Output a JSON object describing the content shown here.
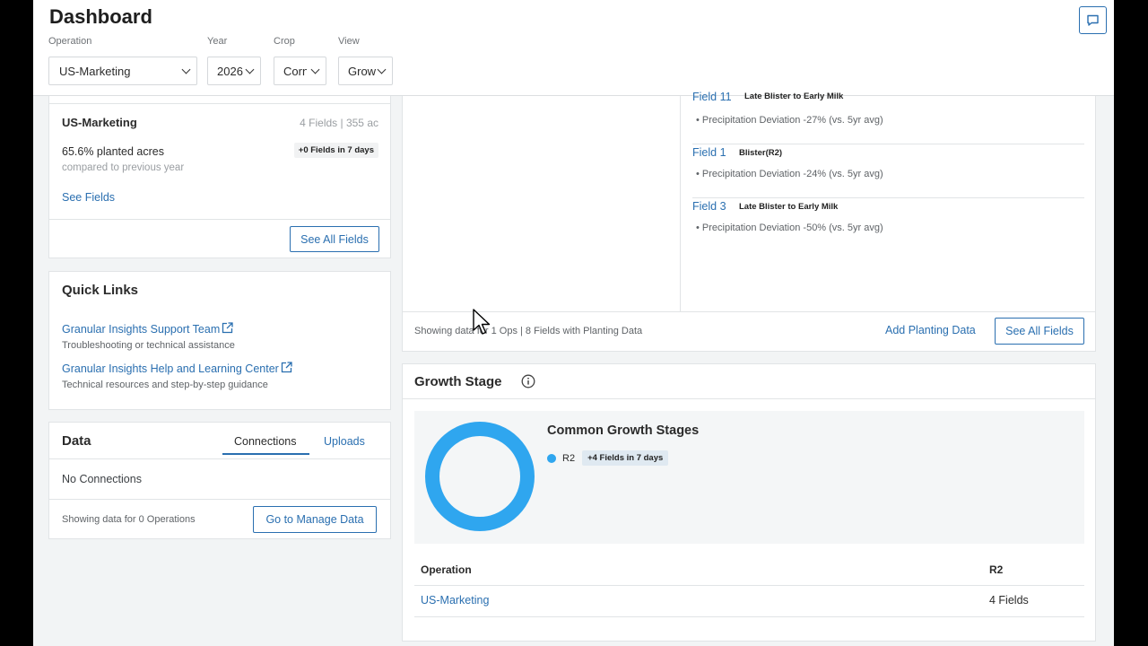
{
  "header": {
    "title": "Dashboard",
    "filters": [
      {
        "label": "Operation",
        "value": "US-Marketing"
      },
      {
        "label": "Year",
        "value": "2026"
      },
      {
        "label": "Crop",
        "value": "Corn"
      },
      {
        "label": "View",
        "value": "Growth"
      }
    ]
  },
  "operations_card": {
    "name": "US-Marketing",
    "meta": "4 Fields | 355 ac",
    "planted": "65.6% planted acres",
    "compared": "compared to previous year",
    "pill": "+0 Fields in 7 days",
    "see_fields": "See Fields",
    "see_all_fields": "See All Fields"
  },
  "quick_links": {
    "title": "Quick Links",
    "items": [
      {
        "label": "Granular Insights Support Team",
        "sub": "Troubleshooting or technical assistance"
      },
      {
        "label": "Granular Insights Help and Learning Center",
        "sub": "Technical resources and step-by-step guidance"
      }
    ]
  },
  "data_card": {
    "title": "Data",
    "tabs": [
      "Connections",
      "Uploads"
    ],
    "empty": "No Connections",
    "footer": "Showing data for 0 Operations",
    "manage_button": "Go to Manage Data"
  },
  "planting_card": {
    "fields": [
      {
        "name": "Field 11",
        "stage": "Late Blister to Early Milk",
        "detail": "• Precipitation Deviation -27% (vs. 5yr avg)"
      },
      {
        "name": "Field 1",
        "stage": "Blister(R2)",
        "detail": "• Precipitation Deviation -24% (vs. 5yr avg)"
      },
      {
        "name": "Field 3",
        "stage": "Late Blister to Early Milk",
        "detail": "• Precipitation Deviation -50% (vs. 5yr avg)"
      }
    ],
    "footer": "Showing data for 1 Ops | 8 Fields with Planting Data",
    "add_planting": "Add Planting Data",
    "see_all_fields": "See All Fields"
  },
  "growth_card": {
    "title": "Growth Stage",
    "common_title": "Common Growth Stages",
    "legend": [
      {
        "label": "R2",
        "pill": "+4 Fields in 7 days",
        "color": "#2fa6ef"
      }
    ],
    "table": {
      "headers": [
        "Operation",
        "R2"
      ],
      "rows": [
        {
          "operation": "US-Marketing",
          "r2": "4 Fields"
        }
      ]
    }
  },
  "colors": {
    "accent": "#2a6fb0",
    "donut": "#2fa6ef"
  }
}
